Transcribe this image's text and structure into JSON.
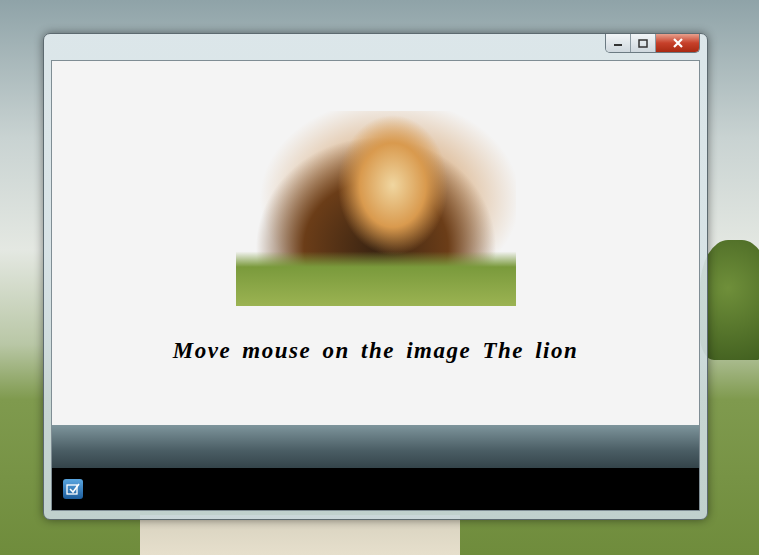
{
  "caption": "Move mouse on the image The lion"
}
